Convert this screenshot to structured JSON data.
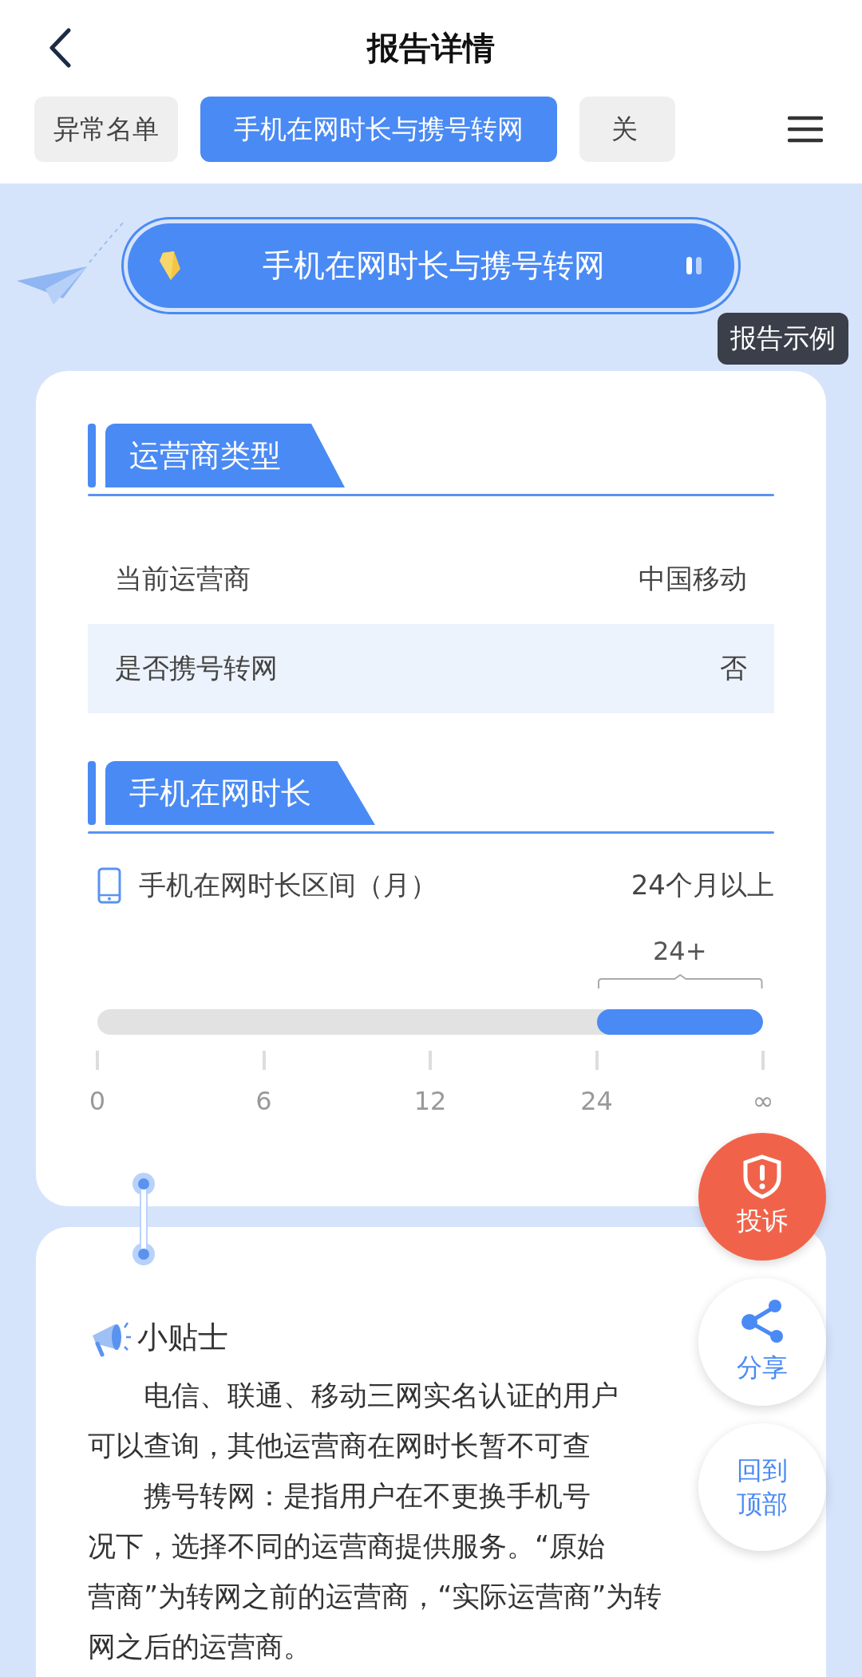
{
  "header": {
    "title": "报告详情"
  },
  "tabs": [
    {
      "label": "异常名单",
      "selected": false
    },
    {
      "label": "手机在网时长与携号转网",
      "selected": true
    },
    {
      "label": "关",
      "selected": false
    }
  ],
  "banner": {
    "title": "手机在网时长与携号转网"
  },
  "example_badge": "报告示例",
  "sections": [
    {
      "title": "运营商类型",
      "rows": [
        {
          "label": "当前运营商",
          "value": "中国移动",
          "shaded": false
        },
        {
          "label": "是否携号转网",
          "value": "否",
          "shaded": true
        }
      ]
    },
    {
      "title": "手机在网时长",
      "range": {
        "label": "手机在网时长区间（月）",
        "value": "24个月以上",
        "marker": "24+",
        "ticks": [
          "0",
          "6",
          "12",
          "24",
          "∞"
        ],
        "segments": [
          {
            "selected": false
          },
          {
            "selected": false
          },
          {
            "selected": false
          },
          {
            "selected": true
          }
        ]
      }
    }
  ],
  "tips": {
    "title": "小贴士",
    "lines": [
      {
        "text": "电信、联通、移动三网实名认证的用户",
        "indent": true
      },
      {
        "text": "可以查询，其他运营商在网时长暂不可查",
        "indent": false
      },
      {
        "text": "携号转网：是指用户在不更换手机号",
        "indent": true
      },
      {
        "text": "况下，选择不同的运营商提供服务。“原始",
        "indent": false
      },
      {
        "text": "营商”为转网之前的运营商，“实际运营商”为转",
        "indent": false
      },
      {
        "text": "网之后的运营商。",
        "indent": false
      }
    ]
  },
  "floating_buttons": [
    {
      "kind": "complaint",
      "label": "投诉"
    },
    {
      "kind": "share",
      "label": "分享"
    },
    {
      "kind": "top",
      "label": "回到顶部"
    }
  ]
}
